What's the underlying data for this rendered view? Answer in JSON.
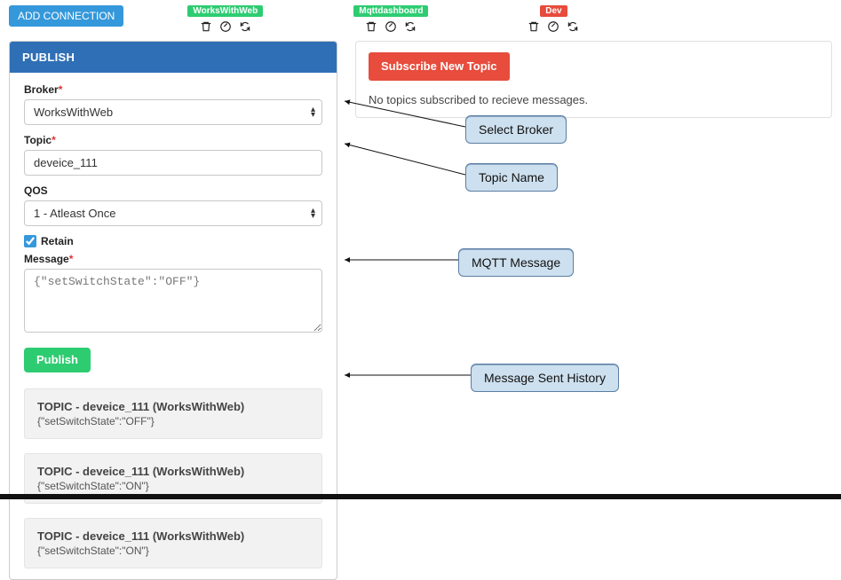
{
  "buttons": {
    "add_connection": "ADD CONNECTION",
    "publish": "Publish",
    "subscribe_new_topic": "Subscribe New Topic"
  },
  "connections": [
    {
      "name": "WorksWithWeb",
      "color": "green"
    },
    {
      "name": "Mqttdashboard",
      "color": "green"
    },
    {
      "name": "Dev",
      "color": "red"
    }
  ],
  "panel": {
    "header": "PUBLISH",
    "broker_label": "Broker",
    "topic_label": "Topic",
    "qos_label": "QOS",
    "retain_label": "Retain",
    "message_label": "Message"
  },
  "form": {
    "broker_value": "WorksWithWeb",
    "topic_value": "deveice_111",
    "qos_value": "1 - Atleast Once",
    "retain_checked": true,
    "message_value": "{\"setSwitchState\":\"OFF\"}"
  },
  "history": [
    {
      "title": "TOPIC - deveice_111 (WorksWithWeb)",
      "payload": "{\"setSwitchState\":\"OFF\"}"
    },
    {
      "title": "TOPIC - deveice_111 (WorksWithWeb)",
      "payload": "{\"setSwitchState\":\"ON\"}"
    },
    {
      "title": "TOPIC - deveice_111 (WorksWithWeb)",
      "payload": "{\"setSwitchState\":\"ON\"}"
    }
  ],
  "right": {
    "no_topics": "No topics subscribed to recieve messages."
  },
  "annotations": {
    "select_broker": "Select Broker",
    "topic_name": "Topic Name",
    "mqtt_message": "MQTT Message",
    "message_history": "Message Sent History"
  }
}
